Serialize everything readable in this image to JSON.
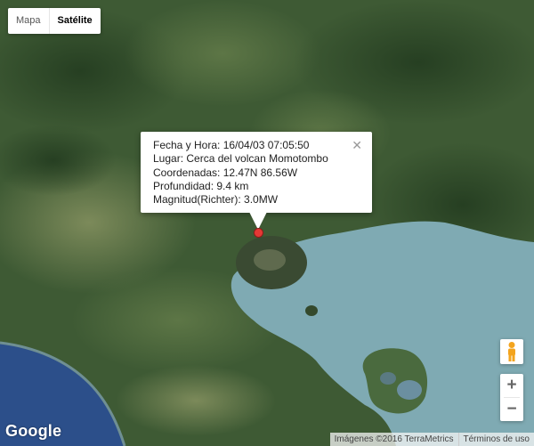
{
  "map_type": {
    "options": [
      "Mapa",
      "Satélite"
    ],
    "selected": "Satélite"
  },
  "info_window": {
    "lines": [
      "Fecha y Hora: 16/04/03 07:05:50",
      "Lugar: Cerca del volcan Momotombo",
      "Coordenadas: 12.47N 86.56W",
      "Profundidad: 9.4 km",
      "Magnitud(Richter): 3.0MW"
    ],
    "close_glyph": "✕"
  },
  "marker": {
    "color": "#e53935",
    "icon": "red-circle-marker"
  },
  "controls": {
    "zoom_in": "+",
    "zoom_out": "−",
    "pegman_icon": "pegman-icon"
  },
  "branding": {
    "logo": "Google",
    "imagery_credit": "Imágenes ©2016 TerraMetrics",
    "terms": "Términos de uso"
  },
  "colors": {
    "lake": "#7faab3",
    "ocean": "#2c4f8a",
    "vegetation": "#3e5a34"
  }
}
